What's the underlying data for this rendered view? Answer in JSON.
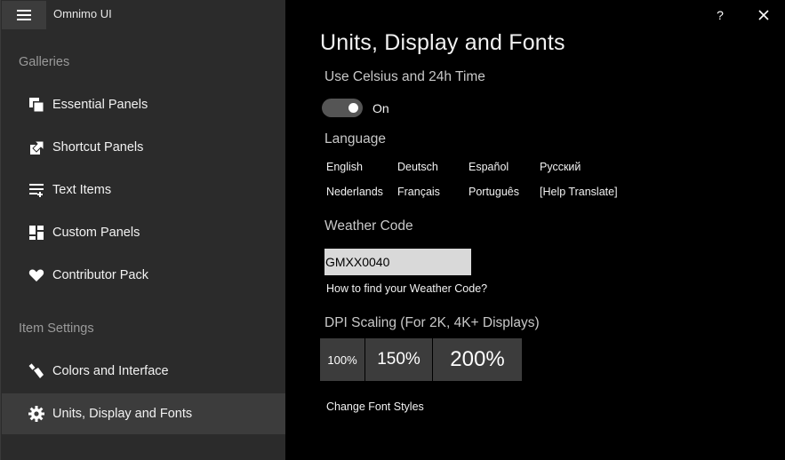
{
  "app": {
    "title": "Omnimo UI"
  },
  "titlebar": {
    "help_label": "?",
    "close_label": "✕"
  },
  "sidebar": {
    "galleries_header": "Galleries",
    "gallery_items": [
      {
        "label": "Essential Panels",
        "icon": "panels-stack-icon"
      },
      {
        "label": "Shortcut Panels",
        "icon": "shortcut-arrow-icon"
      },
      {
        "label": "Text Items",
        "icon": "text-lines-icon"
      },
      {
        "label": "Custom Panels",
        "icon": "custom-panels-icon"
      },
      {
        "label": "Contributor Pack",
        "icon": "heart-icon"
      }
    ],
    "settings_header": "Item Settings",
    "settings_items": [
      {
        "label": "Colors and Interface",
        "icon": "paint-brush-icon"
      },
      {
        "label": "Units, Display and Fonts",
        "icon": "gear-icon",
        "selected": true
      }
    ]
  },
  "main": {
    "title": "Units, Display and Fonts",
    "units_label": "Use Celsius and 24h Time",
    "units_toggle": {
      "state": "On",
      "on": true
    },
    "language_label": "Language",
    "languages": [
      "English",
      "Deutsch",
      "Español",
      "Русский",
      "Nederlands",
      "Français",
      "Português",
      "[Help Translate]"
    ],
    "weather_label": "Weather Code",
    "weather_value": "GMXX0040",
    "weather_help_link": "How to find your Weather Code?",
    "dpi_label": "DPI Scaling (For 2K, 4K+ Displays)",
    "dpi_options": [
      "100%",
      "150%",
      "200%"
    ],
    "font_styles_link": "Change Font Styles"
  },
  "colors": {
    "sidebar_bg": "#2b2b2b",
    "selected_bg": "#3c3c3c",
    "main_bg": "#000000",
    "input_bg": "#d9d9d9"
  }
}
